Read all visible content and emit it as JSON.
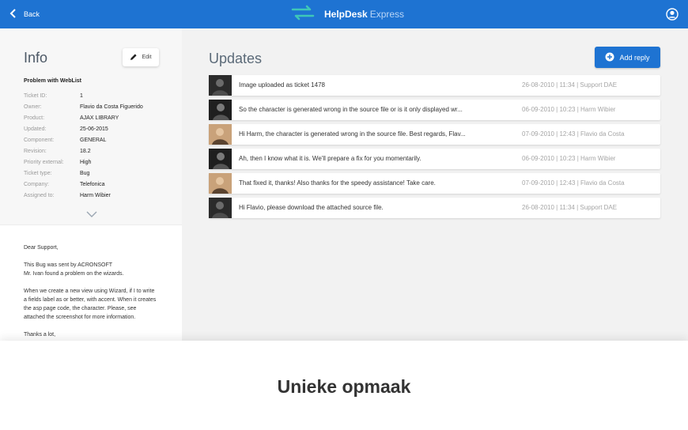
{
  "header": {
    "back_label": "Back",
    "brand_name": "HelpDesk",
    "brand_sub": "Express",
    "accent": "#1e73d2"
  },
  "sidebar": {
    "title": "Info",
    "edit_label": "Edit",
    "ticket_title": "Problem with WebList",
    "props": [
      {
        "label": "Ticket ID:",
        "value": "1"
      },
      {
        "label": "Owner:",
        "value": "Flavio da Costa Figuerido"
      },
      {
        "label": "Product:",
        "value": "AJAX LIBRARY"
      },
      {
        "label": "Updated:",
        "value": "25-06-2015"
      },
      {
        "label": "Component:",
        "value": "GENERAL"
      },
      {
        "label": "Revision:",
        "value": "18.2"
      },
      {
        "label": "Priority external:",
        "value": "High"
      },
      {
        "label": "Ticket type:",
        "value": "Bug"
      },
      {
        "label": "Company:",
        "value": "Telefonica"
      },
      {
        "label": "Assigned to:",
        "value": "Harm Wibier"
      }
    ],
    "description": {
      "p1": "Dear Support,",
      "p2a": "This Bug was sent by ACRONSOFT",
      "p2b": "Mr. Ivan found a problem on the wizards.",
      "p3": "When we create a new view using Wizard, if I to write a fields label as or better, with accent. When it creates the asp page code, the character. Please, see attached the screenshot for more information.",
      "p4": "Thanks a lot,"
    }
  },
  "main": {
    "title": "Updates",
    "add_reply_label": "Add reply",
    "updates": [
      {
        "text": "Image uploaded as ticket 1478",
        "meta": "26-08-2010 | 11:34 | Support DAE",
        "avatar": "support"
      },
      {
        "text": "So the character is generated wrong in the source file or is it only displayed wr...",
        "meta": "06-09-2010 | 10:23 | Harm Wibier",
        "avatar": "harm"
      },
      {
        "text": "Hi Harm, the character is generated wrong in the source file. Best regards, Flav...",
        "meta": "07-09-2010 | 12:43 | Flavio da Costa",
        "avatar": "flavio"
      },
      {
        "text": "Ah, then I know what it is. We'll prepare a fix for you momentarily.",
        "meta": "06-09-2010 | 10:23 | Harm Wibier",
        "avatar": "harm"
      },
      {
        "text": "That fixed it, thanks! Also thanks for the speedy assistance! Take care.",
        "meta": "07-09-2010 | 12:43 | Flavio da Costa",
        "avatar": "flavio"
      },
      {
        "text": "Hi Flavio, please download the attached source file.",
        "meta": "26-08-2010 | 11:34 | Support DAE",
        "avatar": "support"
      }
    ]
  },
  "overlay": {
    "title": "Unieke opmaak"
  }
}
